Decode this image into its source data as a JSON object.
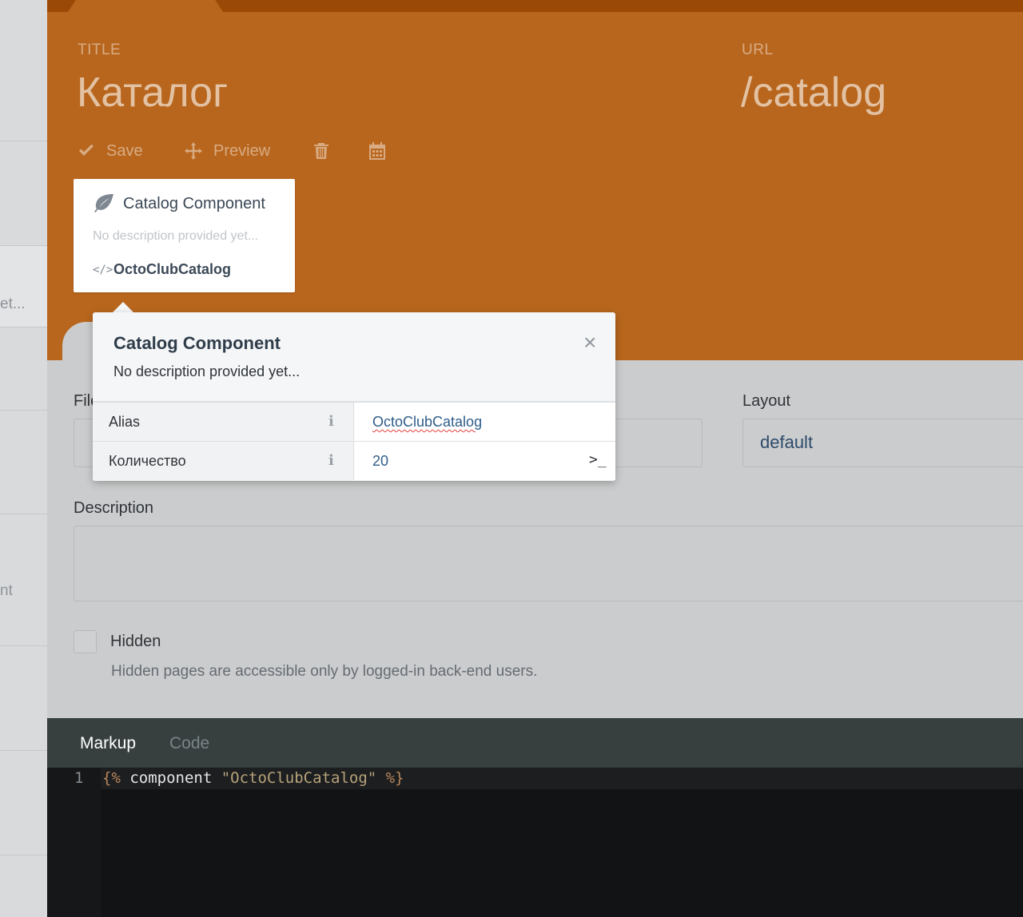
{
  "sidebar": {
    "fragments": [
      "et...",
      "nt"
    ]
  },
  "header": {
    "title_label": "TITLE",
    "title_value": "Каталог",
    "url_label": "URL",
    "url_value": "/catalog",
    "toolbar": {
      "save_label": "Save",
      "preview_label": "Preview"
    }
  },
  "component_card": {
    "title": "Catalog Component",
    "description": "No description provided yet...",
    "alias": "OctoClubCatalog"
  },
  "inspector": {
    "title": "Catalog Component",
    "description": "No description provided yet...",
    "close_symbol": "×",
    "rows": [
      {
        "key": "Alias",
        "value": "OctoClubCatalog"
      },
      {
        "key": "Количество",
        "value": "20"
      }
    ],
    "info_symbol": "i",
    "terminal_symbol": ">_"
  },
  "form": {
    "file_label": "File",
    "layout_label": "Layout",
    "layout_value": "default",
    "description_label": "Description",
    "hidden_label": "Hidden",
    "hidden_help": "Hidden pages are accessible only by logged-in back-end users."
  },
  "editor": {
    "tabs": {
      "markup": "Markup",
      "code": "Code"
    },
    "line_number": "1",
    "code": {
      "open": "{%",
      "keyword": " component ",
      "string": "\"OctoClubCatalog\"",
      "close": " %}"
    }
  },
  "colors": {
    "header_bg": "#b8661d",
    "editor_bg": "#111315"
  }
}
